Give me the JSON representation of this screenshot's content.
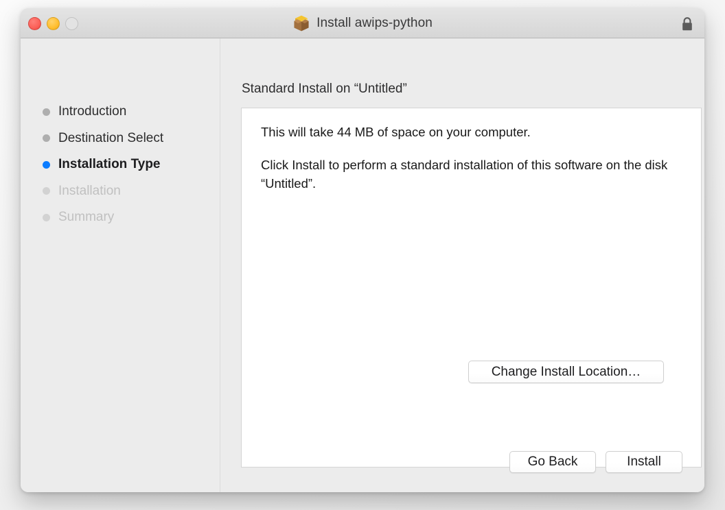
{
  "window": {
    "title": "Install awips-python",
    "title_icon": "package-box-icon",
    "lock_icon": "lock-closed-icon",
    "traffic_lights": [
      {
        "name": "close",
        "color": "#fb6058"
      },
      {
        "name": "minimize",
        "color": "#ffbe2e"
      },
      {
        "name": "zoom",
        "color": "#e3e3e3"
      }
    ]
  },
  "sidebar": {
    "steps": [
      {
        "label": "Introduction",
        "state": "done"
      },
      {
        "label": "Destination Select",
        "state": "done"
      },
      {
        "label": "Installation Type",
        "state": "active"
      },
      {
        "label": "Installation",
        "state": "upcoming"
      },
      {
        "label": "Summary",
        "state": "upcoming"
      }
    ]
  },
  "content": {
    "heading": "Standard Install on “Untitled”",
    "paragraphs": [
      "This will take 44 MB of space on your computer.",
      "Click Install to perform a standard installation of this software on the disk “Untitled”."
    ],
    "change_location_label": "Change Install Location…"
  },
  "footer": {
    "go_back_label": "Go Back",
    "install_label": "Install"
  },
  "colors": {
    "accent_blue": "#0b7cff",
    "window_background": "#ececec",
    "panel_background": "#ffffff"
  }
}
